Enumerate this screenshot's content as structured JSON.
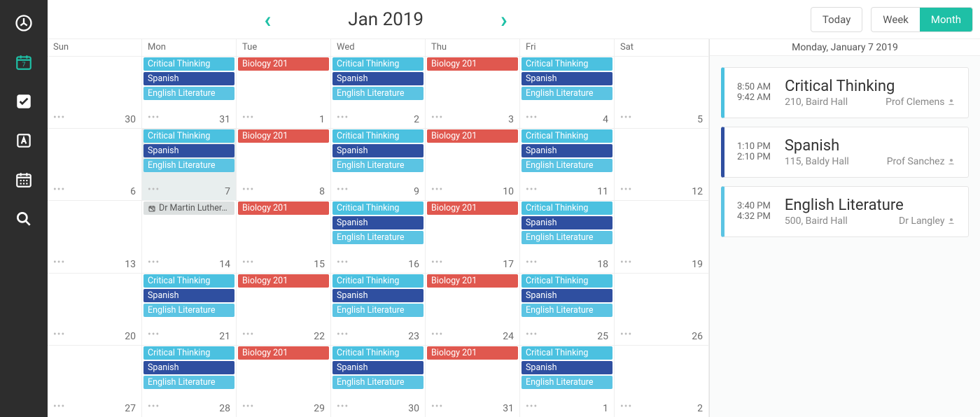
{
  "nav": {
    "month_label": "Jan 2019",
    "today_label": "Today",
    "week_label": "Week",
    "month_btn": "Month"
  },
  "side_header": "Monday, January 7 2019",
  "day_names": [
    "Sun",
    "Mon",
    "Tue",
    "Wed",
    "Thu",
    "Fri",
    "Sat"
  ],
  "holiday_label": "Dr Martin Luther…",
  "ev_labels": {
    "crit": "Critical Thinking",
    "bio": "Biology 201",
    "span": "Spanish",
    "eng": "English Literature"
  },
  "weeks": [
    {
      "dates": [
        30,
        31,
        1,
        2,
        3,
        4,
        5
      ],
      "pattern": "A"
    },
    {
      "dates": [
        6,
        7,
        8,
        9,
        10,
        11,
        12
      ],
      "pattern": "A",
      "selected": 1
    },
    {
      "dates": [
        13,
        14,
        15,
        16,
        17,
        18,
        19
      ],
      "pattern": "B"
    },
    {
      "dates": [
        20,
        21,
        22,
        23,
        24,
        25,
        26
      ],
      "pattern": "A"
    },
    {
      "dates": [
        27,
        28,
        29,
        30,
        31,
        1,
        2
      ],
      "pattern": "A"
    }
  ],
  "classes": [
    {
      "start": "8:50 AM",
      "end": "9:42 AM",
      "name": "Critical Thinking",
      "room": "210, Baird Hall",
      "prof": "Prof Clemens",
      "color": "crit-c"
    },
    {
      "start": "1:10 PM",
      "end": "2:10 PM",
      "name": "Spanish",
      "room": "115, Baldy Hall",
      "prof": "Prof Sanchez",
      "color": "span-c"
    },
    {
      "start": "3:40 PM",
      "end": "4:32 PM",
      "name": "English Literature",
      "room": "500, Baird Hall",
      "prof": "Dr Langley",
      "color": "eng-c"
    }
  ],
  "calendar_badge": "7"
}
